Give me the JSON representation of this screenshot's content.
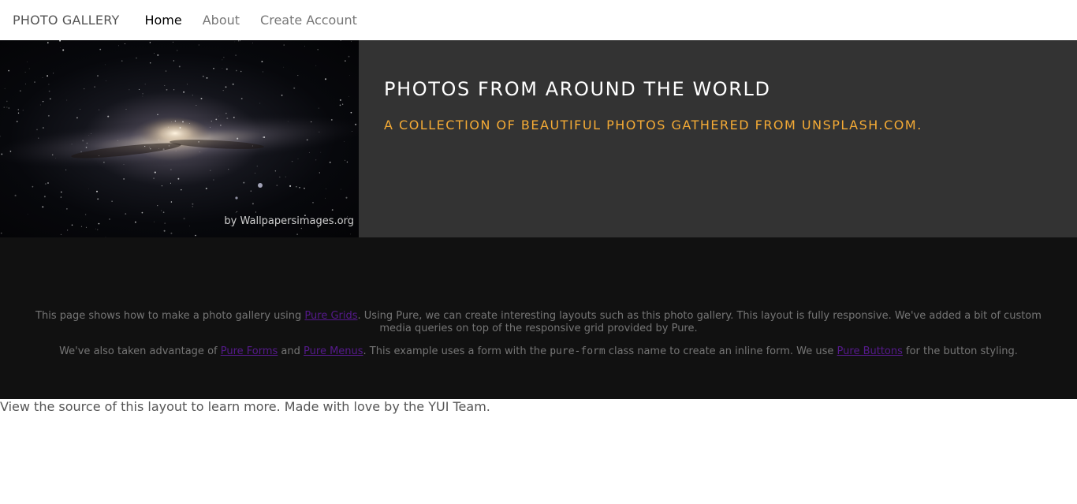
{
  "nav": {
    "brand": "PHOTO GALLERY",
    "items": [
      {
        "label": "Home",
        "selected": true
      },
      {
        "label": "About",
        "selected": false
      },
      {
        "label": "Create Account",
        "selected": false
      }
    ]
  },
  "hero": {
    "photo_description_icon": "milky-way-photo",
    "photo_credit": "by Wallpapersimages.org",
    "title": "PHOTOS FROM AROUND THE WORLD",
    "subtitle": "A COLLECTION OF BEAUTIFUL PHOTOS GATHERED FROM UNSPLASH.COM."
  },
  "info": {
    "p1_before": "This page shows how to make a photo gallery using ",
    "p1_link": "Pure Grids",
    "p1_after": ". Using Pure, we can create interesting layouts such as this photo gallery. This layout is fully responsive. We've added a bit of custom media queries on top of the responsive grid provided by Pure.",
    "p2_before": "We've also taken advantage of ",
    "p2_link1": "Pure Forms",
    "p2_mid1": " and ",
    "p2_link2": "Pure Menus",
    "p2_mid2": ". This example uses a form with the ",
    "p2_code": "pure-form",
    "p2_mid3": " class name to create an inline form. We use ",
    "p2_link3": "Pure Buttons",
    "p2_after": " for the button styling."
  },
  "footer": {
    "legal": "View the source of this layout to learn more. Made with love by the YUI Team."
  },
  "colors": {
    "accent": "#f5ab35",
    "hero_bg": "#333333",
    "info_bg": "#111111",
    "link": "#551a8b"
  }
}
